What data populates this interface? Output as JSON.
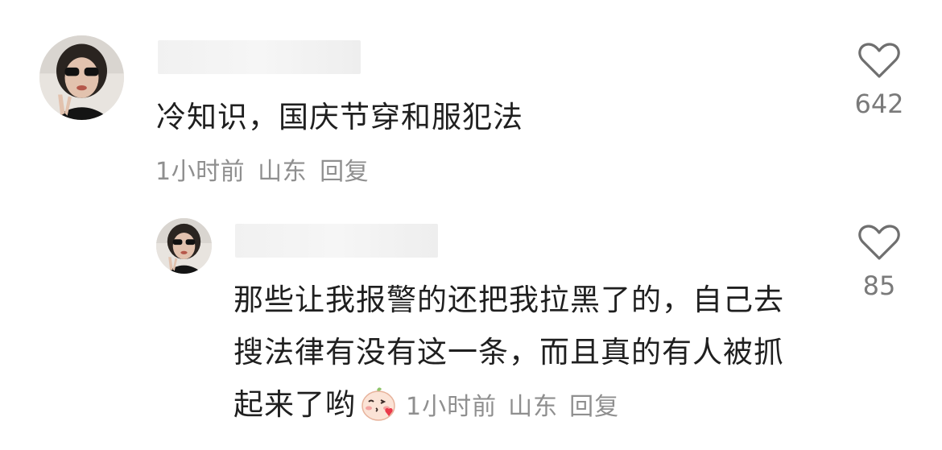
{
  "comment": {
    "text": "冷知识，国庆节穿和服犯法",
    "time": "1小时前",
    "location": "山东",
    "reply_label": "回复",
    "likes": "642"
  },
  "reply": {
    "text": "那些让我报警的还把我拉黑了的，自己去搜法律有没有这一条，而且真的有人被抓起来了哟",
    "time": "1小时前",
    "location": "山东",
    "reply_label": "回复",
    "likes": "85"
  },
  "icons": {
    "like": "heart-outline-icon",
    "emoji": "blush-kiss-emoji-icon"
  },
  "colors": {
    "text": "#1f1f1f",
    "meta": "#8f8f8f",
    "count": "#7a7a7a",
    "heart_stroke": "#6f6f6f"
  }
}
